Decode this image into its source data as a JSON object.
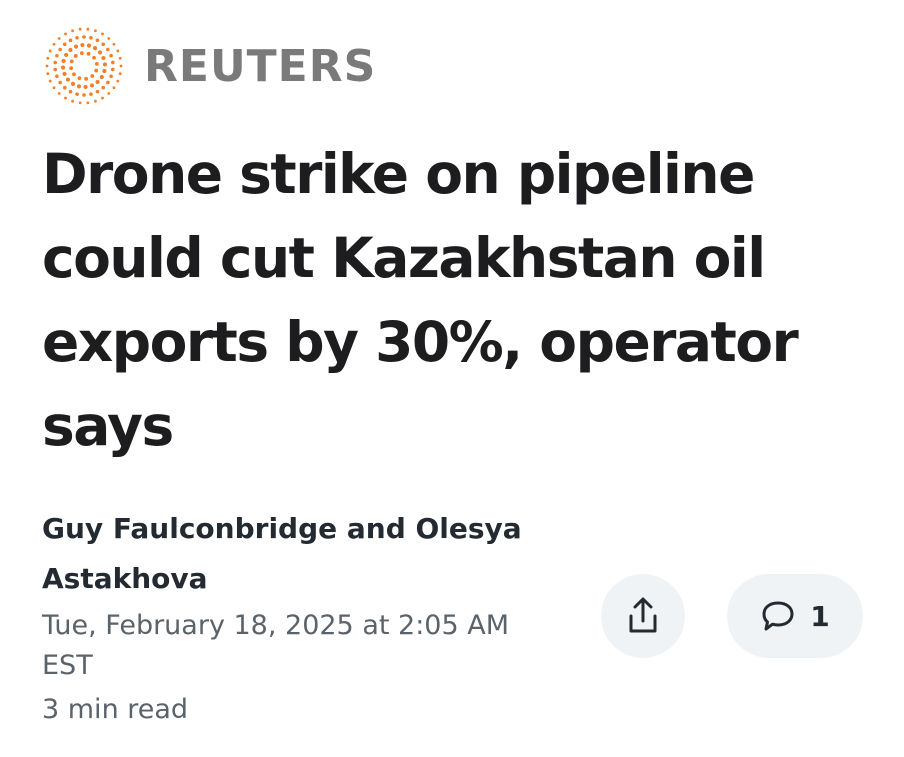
{
  "publisher": {
    "name": "REUTERS",
    "logo_icon": "reuters-dot-ring-logo",
    "logo_color": "#f47f24",
    "name_color": "#7a7a7a"
  },
  "article": {
    "headline": "Drone strike on pipeline could cut Kazakhstan oil exports by 30%, operator says",
    "byline": "Guy Faulconbridge and Olesya Astakhova",
    "timestamp": "Tue, February 18, 2025 at 2:05 AM EST",
    "read_time": "3 min read"
  },
  "actions": {
    "share_icon": "share-icon",
    "comment_icon": "comment-icon",
    "comment_count": "1",
    "button_background": "#f0f3f5"
  }
}
